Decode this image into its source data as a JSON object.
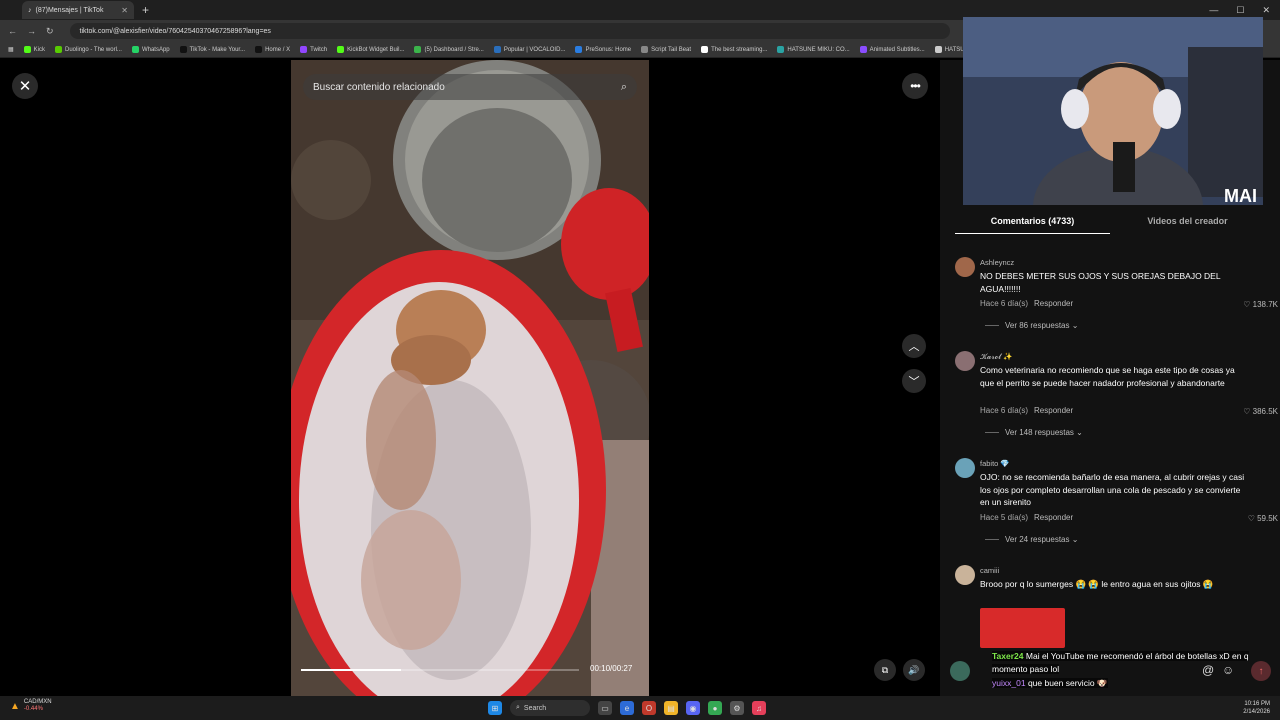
{
  "browser": {
    "tab_title": "(87)Mensajes | TikTok",
    "url": "tiktok.com/@alexisfier/video/7604254037046725896?lang=es",
    "bookmarks": [
      "Kick",
      "Duolingo - The worl...",
      "WhatsApp",
      "TikTok - Make Your...",
      "Home / X",
      "Twitch",
      "KickBot Widget Buil...",
      "(5) Dashboard / Stre...",
      "Popular | VOCALOID...",
      "PreSonus: Home",
      "Script Tail Beat",
      "The best streaming...",
      "HATSUNE MIKU: CO...",
      "Animated Subtitles...",
      "HATSUNE M"
    ],
    "bookmark_colors": [
      "#53fc18",
      "#58cc02",
      "#25d366",
      "#111111",
      "#111111",
      "#9146ff",
      "#53fc18",
      "#3bb44b",
      "#2a6ebb",
      "#2a7de1",
      "#888888",
      "#ffffff",
      "#2aa3a3",
      "#8a4dff",
      "#cccccc"
    ]
  },
  "video": {
    "search_placeholder": "Buscar contenido relacionado",
    "time": "00:10/00:27",
    "progress_fraction": 0.36
  },
  "panel": {
    "tab_comments": "Comentarios (4733)",
    "tab_creator": "Videos del creador",
    "comments": [
      {
        "user": "Ashleyncz",
        "text": "NO DEBES METER SUS OJOS Y SUS OREJAS DEBAJO DEL AGUA!!!!!!!",
        "time": "Hace 6 día(s)",
        "reply": "Responder",
        "likes": "138.7K",
        "replies": "Ver 86 respuestas",
        "avatar_color": "#a0674a"
      },
      {
        "user": "𝓚𝓪𝓻𝓸𝓵 ✨",
        "text": "Como veterinaria no recomiendo que se haga este tipo de cosas ya que el perrito se puede hacer nadador profesional y abandonarte",
        "time": "Hace 6 día(s)",
        "reply": "Responder",
        "likes": "386.5K",
        "replies": "Ver 148 respuestas",
        "avatar_color": "#8a6f72"
      },
      {
        "user": "fabito 💎",
        "text": "OJO: no se recomienda bañarlo de esa manera, al cubrir orejas y casi los ojos por completo desarrollan una cola de pescado y se convierte en un sirenito",
        "time": "Hace 5 día(s)",
        "reply": "Responder",
        "likes": "59.5K",
        "replies": "Ver 24 respuestas",
        "avatar_color": "#6aa2b8"
      },
      {
        "user": "camiii",
        "text": "Brooo por q lo sumerges 😭 😭 le entro agua en sus ojitos 😭",
        "avatar_color": "#c9b39a"
      }
    ]
  },
  "chat": [
    {
      "name": "Taxer24",
      "message": "Mai el YouTube me recomendó el árbol de botellas xD en q momento paso lol"
    },
    {
      "name": "yuixx_01",
      "message": "que buen servicio 🐶"
    }
  ],
  "webcam": {
    "watermark": "MAI"
  },
  "taskbar": {
    "ticker": "CAD/MXN",
    "ticker_change": "-0.44%",
    "search": "Search",
    "time": "10:16 PM",
    "date": "2/14/2026"
  }
}
